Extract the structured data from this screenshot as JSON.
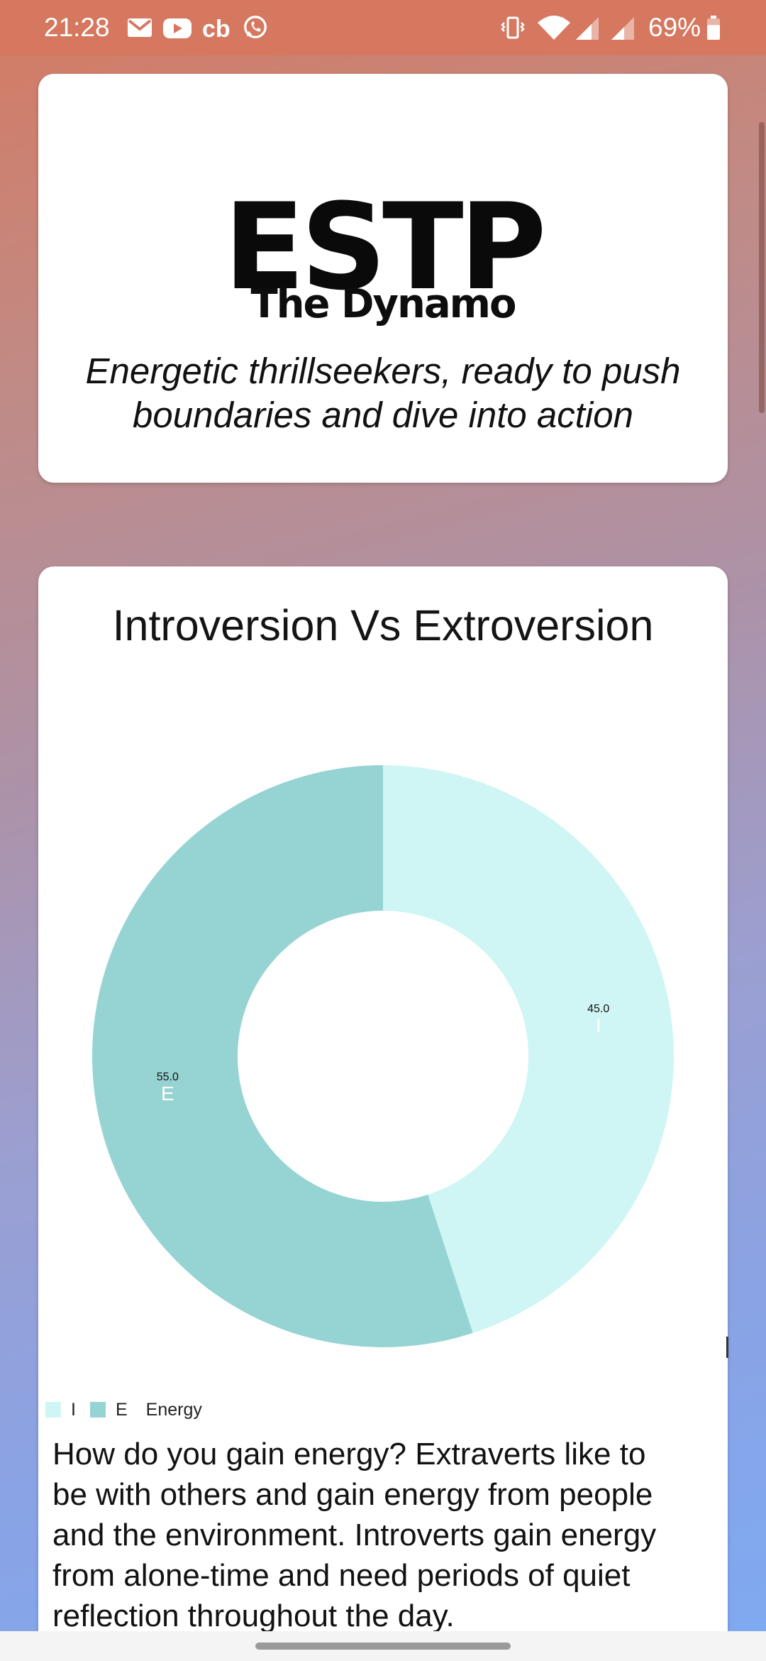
{
  "status_bar": {
    "time": "21:28",
    "battery_percent": "69%",
    "notification_icons": [
      "gmail-icon",
      "youtube-icon",
      "cb-icon",
      "whatsapp-icon"
    ],
    "system_icons": [
      "vibrate-icon",
      "wifi-icon",
      "signal-icon",
      "signal-icon",
      "battery-icon"
    ],
    "battery_level": 0.69
  },
  "type_card": {
    "code": "ESTP",
    "name": "The Dynamo",
    "tagline_line1": "Energetic thrillseekers, ready to push",
    "tagline_line2": "boundaries and dive into action"
  },
  "chart_card": {
    "title": "Introversion Vs Extroversion",
    "legend_suffix": "Energy",
    "description_lines": [
      "How do you gain energy? Extraverts like to",
      "be with others and gain energy from people",
      "and the environment. Introverts gain energy",
      "from alone-time and need periods of quiet",
      "reflection throughout the day."
    ]
  },
  "chart_data": {
    "type": "pie",
    "donut": true,
    "title": "Introversion Vs Extroversion",
    "categories": [
      "I",
      "E"
    ],
    "values": [
      45.0,
      55.0
    ],
    "value_labels": [
      "45.0",
      "55.0"
    ],
    "colors": [
      "#cff6f4",
      "#96d4d4"
    ],
    "legend": {
      "entries": [
        "I",
        "E"
      ],
      "position": "bottom-left",
      "suffix": "Energy"
    }
  },
  "colors": {
    "status_bar": "#d5785f",
    "gradient_top": "#d47b63",
    "gradient_bottom": "#7eaaf2",
    "card_bg": "#ffffff"
  }
}
